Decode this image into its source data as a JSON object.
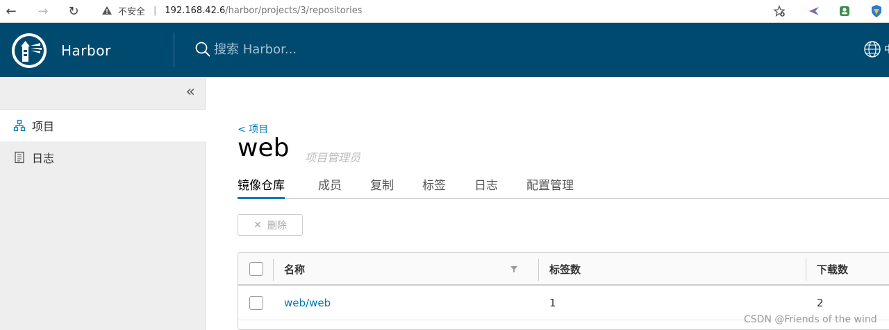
{
  "browser": {
    "insecure_label": "不安全",
    "url_host": "192.168.42.6",
    "url_path": "/harbor/projects/3/repositories"
  },
  "header": {
    "brand": "Harbor",
    "search_placeholder": "搜索 Harbor...",
    "lang_label": "中"
  },
  "sidebar": {
    "items": [
      {
        "label": "项目",
        "icon": "projects-icon",
        "active": true
      },
      {
        "label": "日志",
        "icon": "logs-icon",
        "active": false
      }
    ]
  },
  "project": {
    "back_label": "< 项目",
    "name": "web",
    "role": "项目管理员"
  },
  "tabs": [
    {
      "label": "镜像仓库",
      "active": true
    },
    {
      "label": "成员"
    },
    {
      "label": "复制"
    },
    {
      "label": "标签"
    },
    {
      "label": "日志"
    },
    {
      "label": "配置管理"
    }
  ],
  "toolbar": {
    "delete_label": "删除"
  },
  "table": {
    "columns": [
      "名称",
      "标签数",
      "下载数"
    ],
    "rows": [
      {
        "name": "web/web",
        "tags": "1",
        "pulls": "2"
      }
    ]
  },
  "watermark": "CSDN @Friends of the wind",
  "colors": {
    "header_bg": "#004a70",
    "accent": "#0079b8",
    "sidebar_bg": "#eeeeee"
  }
}
